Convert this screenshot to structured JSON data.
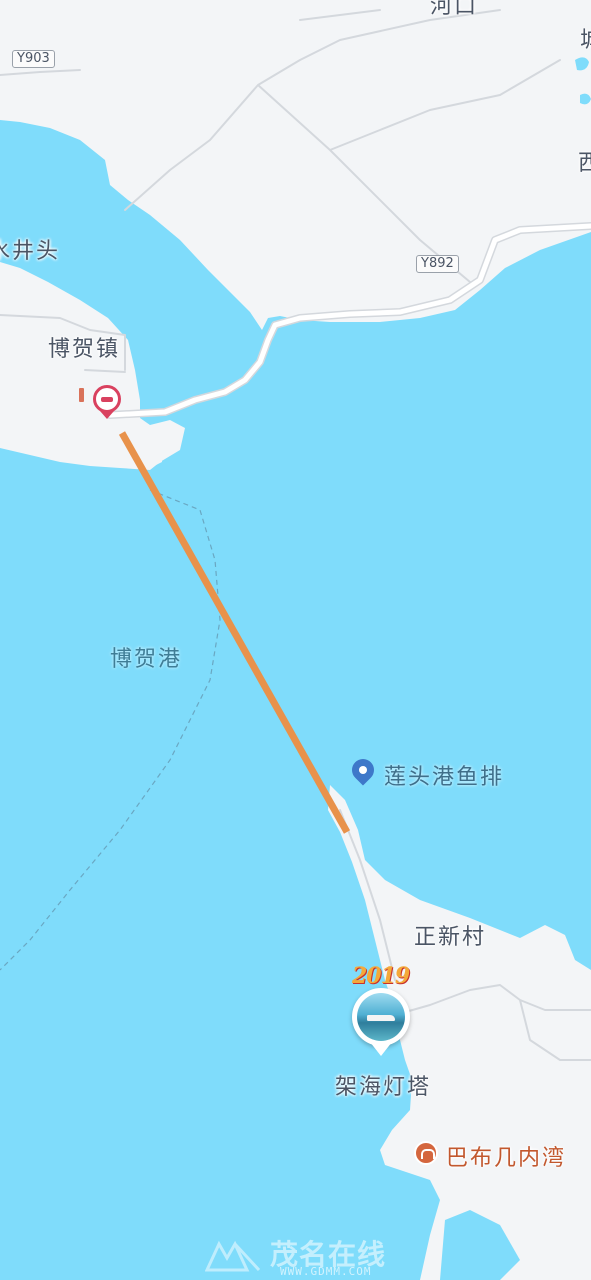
{
  "colors": {
    "water": "#7fdcfb",
    "land": "#f3f5f7",
    "road": "#ffffff",
    "road_outline": "#d4d8dd",
    "route": "#e8924b",
    "ferry_line": "#6aa7c2"
  },
  "labels": {
    "top_partial": "河口",
    "right_partial_1": "城",
    "right_partial_2": "西",
    "jingtou": "水井头",
    "bohe_town": "博贺镇",
    "bohe_port": "博贺港",
    "lianto_fish": "莲头港鱼排",
    "zhengxin": "正新村",
    "lighthouse": "架海灯塔",
    "babuji": "巴布几内湾"
  },
  "road_shields": {
    "y903": "Y903",
    "y892": "Y892"
  },
  "icons": {
    "no_entry_pin": "no-entry-icon",
    "location_pin": "location-pin-icon",
    "photo_pin": "photo-pin-icon",
    "scenic_badge": "scenic-spot-icon"
  },
  "decoration": {
    "badge_text": "2019"
  },
  "watermark": {
    "brand": "茂名在线",
    "url": "WWW.GDMM.COM"
  }
}
